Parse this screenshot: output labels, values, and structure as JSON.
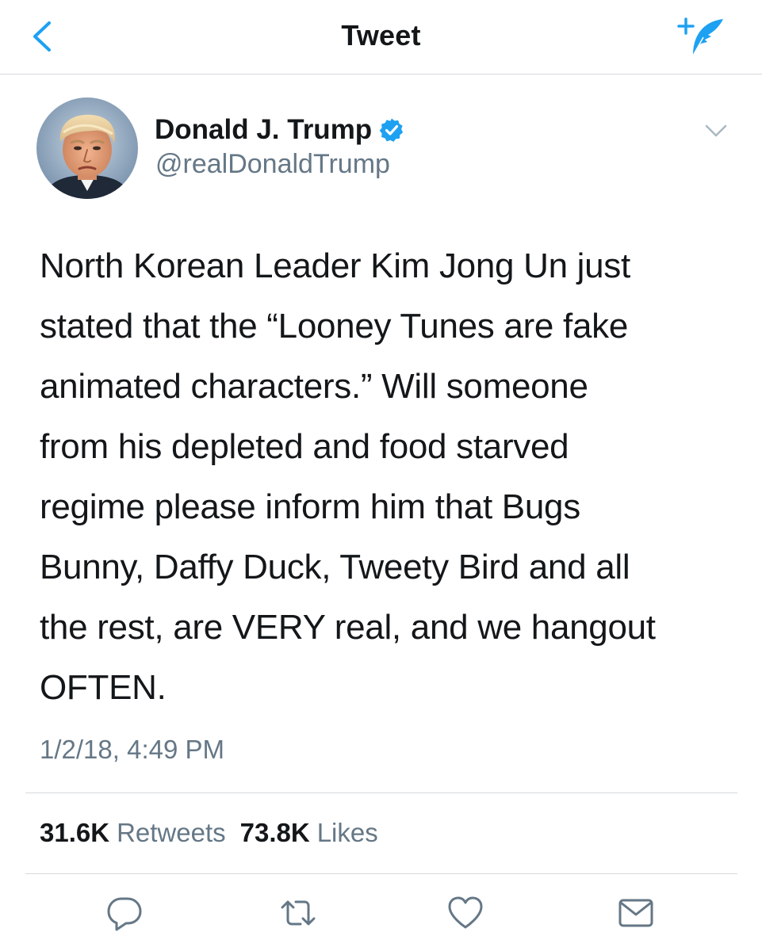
{
  "navbar": {
    "title": "Tweet",
    "back_icon": "chevron-left-icon",
    "compose_icon": "compose-tweet-icon",
    "accent_color": "#1da1f2"
  },
  "author": {
    "name": "Donald J. Trump",
    "handle": "@realDonaldTrump",
    "verified": true,
    "verified_icon": "verified-badge-icon",
    "menu_icon": "chevron-down-icon"
  },
  "tweet": {
    "lines": [
      "North Korean Leader Kim Jong Un just",
      "stated that the “Looney Tunes are fake",
      "animated characters.” Will someone",
      "from his depleted and food starved",
      "regime please inform him that Bugs",
      "Bunny, Daffy Duck, Tweety Bird and all",
      "the rest, are VERY real, and we hangout",
      "OFTEN."
    ],
    "timestamp": "1/2/18, 4:49 PM"
  },
  "stats": {
    "retweets_count": "31.6K",
    "retweets_label": "Retweets",
    "likes_count": "73.8K",
    "likes_label": "Likes"
  },
  "actions": {
    "reply_icon": "reply-icon",
    "retweet_icon": "retweet-icon",
    "like_icon": "heart-icon",
    "share_icon": "envelope-icon",
    "icon_color": "#657786"
  }
}
